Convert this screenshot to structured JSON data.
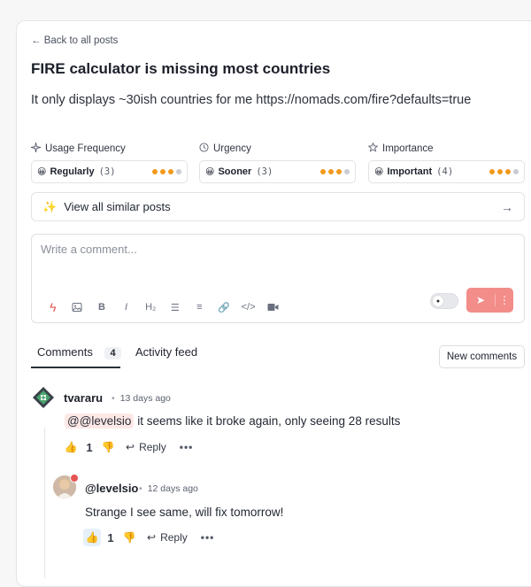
{
  "nav": {
    "back_label": "← Back to all posts"
  },
  "post": {
    "title": "FIRE calculator is missing most countries",
    "description": "It only displays ~30ish countries for me https://nomads.com/fire?defaults=true"
  },
  "metrics": [
    {
      "label": "Usage Frequency",
      "icon": "sparkle-icon",
      "emoji": "😀",
      "value": "Regularly",
      "count": "(3)",
      "level": 3,
      "max": 4
    },
    {
      "label": "Urgency",
      "icon": "clock-icon",
      "emoji": "😀",
      "value": "Sooner",
      "count": "(3)",
      "level": 3,
      "max": 4
    },
    {
      "label": "Importance",
      "icon": "star-icon",
      "emoji": "😀",
      "value": "Important",
      "count": "(4)",
      "level": 3,
      "max": 4
    }
  ],
  "similar": {
    "label": "View all similar posts"
  },
  "composer": {
    "placeholder": "Write a comment...",
    "tools": [
      "bolt-icon",
      "image-icon",
      "bold-icon",
      "italic-icon",
      "heading-icon",
      "bullet-list-icon",
      "numbered-list-icon",
      "link-icon",
      "code-icon",
      "video-icon"
    ]
  },
  "tabs": {
    "comments_label": "Comments",
    "comments_count": "4",
    "activity_label": "Activity feed",
    "new_comments_label": "New comments"
  },
  "comments": [
    {
      "author": "tvararu",
      "time": "13 days ago",
      "mention": "@@levelsio",
      "text": " it seems like it broke again, only seeing 28 results",
      "likes": "1",
      "reply_label": "Reply"
    },
    {
      "author": "@levelsio",
      "time": "12 days ago",
      "text": "Strange I see same, will fix tomorrow!",
      "likes": "1",
      "reply_label": "Reply"
    }
  ],
  "colors": {
    "accent_red": "#f38d8a",
    "dot_orange": "#f29a1a",
    "mention_bg": "#fde8e6"
  }
}
